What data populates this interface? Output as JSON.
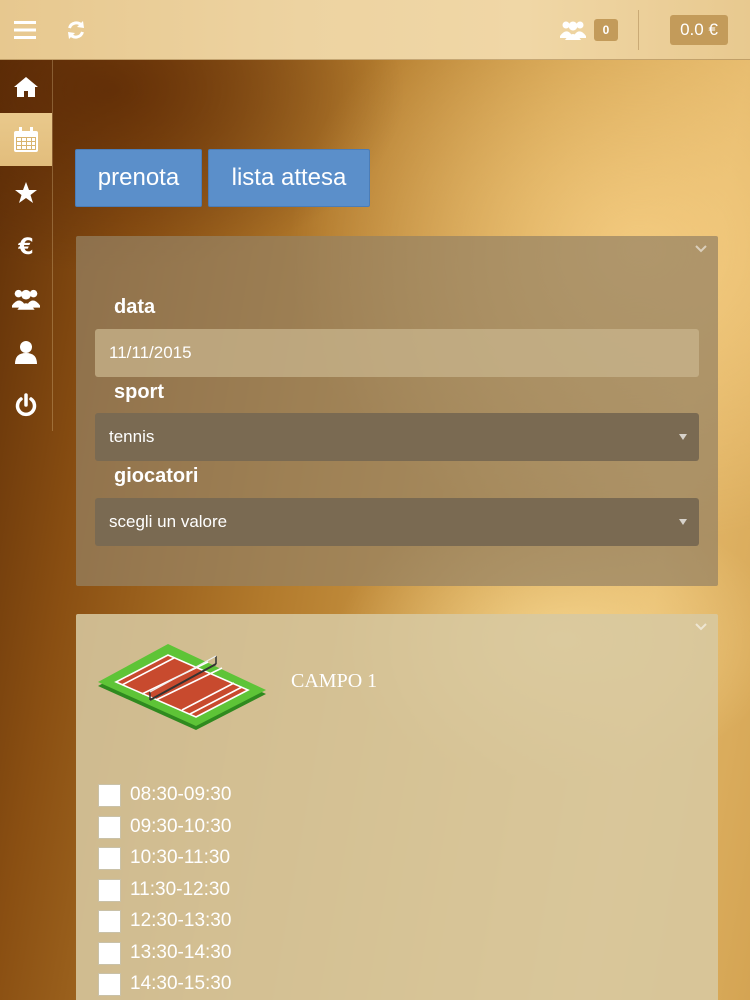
{
  "topbar": {
    "menu_icon": "hamburger-menu-icon",
    "refresh_icon": "refresh-icon",
    "users_icon": "users-icon",
    "users_count": "0",
    "credit": "0.0 €"
  },
  "sidebar": {
    "items": [
      {
        "icon": "home-icon",
        "active": false
      },
      {
        "icon": "calendar-icon",
        "active": true
      },
      {
        "icon": "star-icon",
        "active": false
      },
      {
        "icon": "euro-icon",
        "active": false
      },
      {
        "icon": "users-icon",
        "active": false
      },
      {
        "icon": "user-icon",
        "active": false
      },
      {
        "icon": "power-icon",
        "active": false
      }
    ]
  },
  "actions": {
    "prenota": "prenota",
    "lista_attesa": "lista attesa"
  },
  "form": {
    "date_label": "data",
    "date_value": "11/11/2015",
    "sport_label": "sport",
    "sport_value": "tennis",
    "players_label": "giocatori",
    "players_value": "scegli un valore"
  },
  "court": {
    "name": "CAMPO 1",
    "slots": [
      "08:30-09:30",
      "09:30-10:30",
      "10:30-11:30",
      "11:30-12:30",
      "12:30-13:30",
      "13:30-14:30",
      "14:30-15:30"
    ]
  },
  "colors": {
    "button_blue": "#5b8fca",
    "badge_tan": "#c39b5a",
    "select_brown": "#7a6a52"
  }
}
